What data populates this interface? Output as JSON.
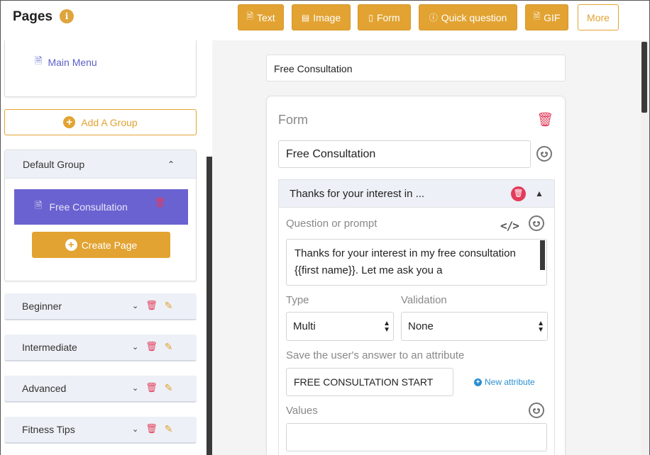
{
  "header": {
    "title": "Pages",
    "info_icon": "i",
    "toolbar": [
      {
        "label": "Text",
        "icon": "document-icon"
      },
      {
        "label": "Image",
        "icon": "image-icon"
      },
      {
        "label": "Form",
        "icon": "form-icon"
      },
      {
        "label": "Quick question",
        "icon": "question-icon"
      },
      {
        "label": "GIF",
        "icon": "gif-icon"
      }
    ],
    "more_label": "More"
  },
  "sidebar": {
    "main_menu_label": "Main Menu",
    "add_group_label": "Add A Group",
    "default_group": {
      "label": "Default Group",
      "active_page": "Free Consultation",
      "create_page_label": "Create Page"
    },
    "groups": [
      {
        "label": "Beginner"
      },
      {
        "label": "Intermediate"
      },
      {
        "label": "Advanced"
      },
      {
        "label": "Fitness Tips"
      }
    ]
  },
  "editor": {
    "page_title": "Free Consultation",
    "form": {
      "heading": "Form",
      "name": "Free Consultation",
      "question": {
        "summary": "Thanks for your interest in ...",
        "prompt_label": "Question or prompt",
        "prompt_text": "Thanks for your interest in my free consultation {{first name}}. Let me ask you a",
        "type_label": "Type",
        "type_value": "Multi",
        "validation_label": "Validation",
        "validation_value": "None",
        "attribute_label": "Save the user's answer to an attribute",
        "attribute_value": "FREE CONSULTATION START",
        "new_attribute_label": "New attribute",
        "values_label": "Values",
        "values_value": ""
      }
    }
  },
  "colors": {
    "accent": "#e2a332",
    "active_page": "#6a62d0",
    "danger": "#e33b5a",
    "link": "#2a8fd0"
  }
}
